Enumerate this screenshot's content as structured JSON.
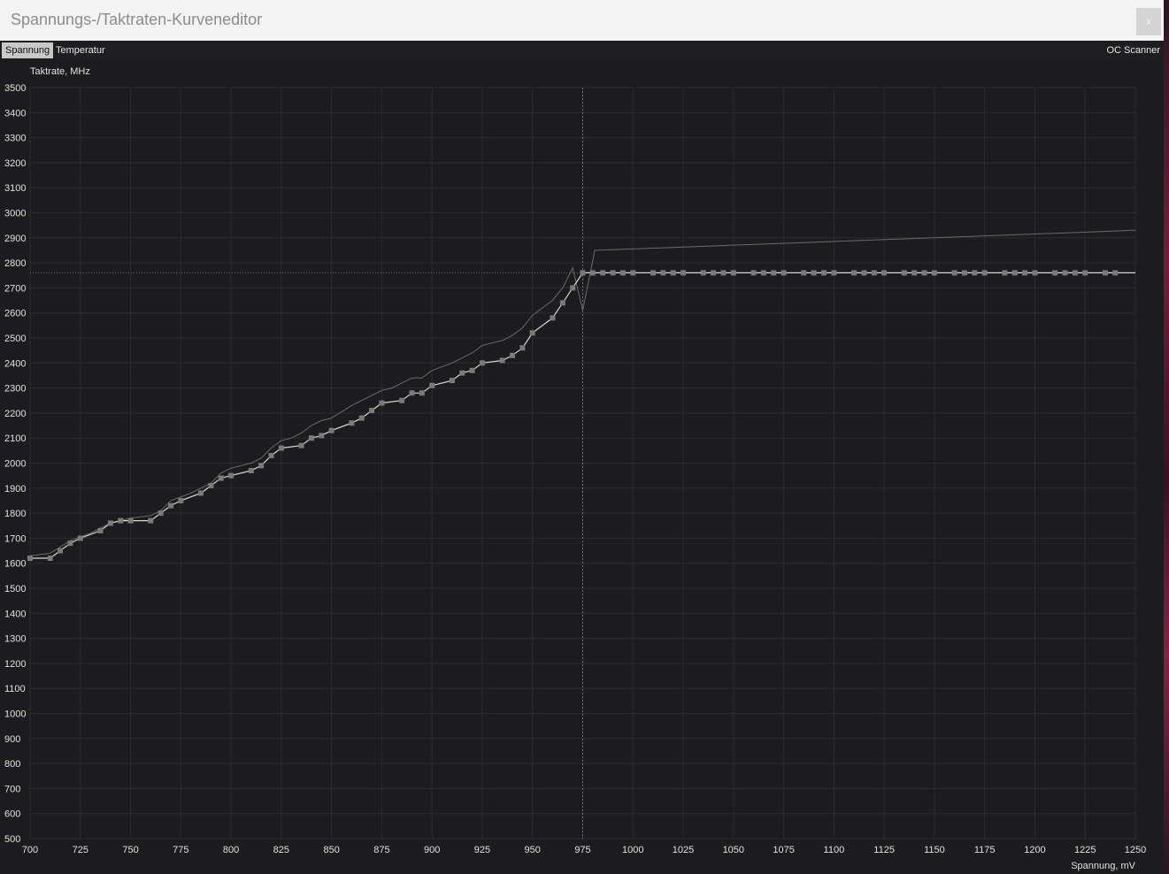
{
  "window": {
    "title": "Spannungs-/Taktraten-Kurveneditor",
    "close_label": "x"
  },
  "tabs": [
    {
      "label": "Spannung",
      "active": true
    },
    {
      "label": "Temperatur",
      "active": false
    }
  ],
  "toolbar": {
    "oc_scanner_label": "OC Scanner"
  },
  "colors": {
    "background": "#1c1c1e",
    "grid": "#2c2c2e",
    "curve": "#d8d8d8",
    "point": "#7a7a7a",
    "reference": "#6a6a6a"
  },
  "chart_data": {
    "type": "line",
    "ylabel": "Taktrate, MHz",
    "xlabel": "Spannung, mV",
    "xlim": [
      700,
      1250
    ],
    "ylim": [
      500,
      3500
    ],
    "x_ticks": [
      700,
      725,
      750,
      775,
      800,
      825,
      850,
      875,
      900,
      925,
      950,
      975,
      1000,
      1025,
      1050,
      1075,
      1100,
      1125,
      1150,
      1175,
      1200,
      1225,
      1250
    ],
    "y_ticks": [
      500,
      600,
      700,
      800,
      900,
      1000,
      1100,
      1200,
      1300,
      1400,
      1500,
      1600,
      1700,
      1800,
      1900,
      2000,
      2100,
      2200,
      2300,
      2400,
      2500,
      2600,
      2700,
      2800,
      2900,
      3000,
      3100,
      3200,
      3300,
      3400,
      3500
    ],
    "grid": true,
    "cursor_voltage": 975,
    "cursor_clock": 2760,
    "series": [
      {
        "role": "reference",
        "x": [
          700,
          710,
          720,
          730,
          740,
          750,
          760,
          765,
          770,
          780,
          790,
          795,
          800,
          810,
          815,
          820,
          825,
          830,
          835,
          840,
          845,
          850,
          860,
          870,
          875,
          880,
          885,
          890,
          895,
          900,
          910,
          915,
          920,
          925,
          930,
          935,
          940,
          945,
          950,
          955,
          960,
          965,
          970,
          975,
          981,
          1250
        ],
        "y": [
          1630,
          1640,
          1690,
          1720,
          1760,
          1780,
          1790,
          1810,
          1850,
          1880,
          1920,
          1960,
          1980,
          2000,
          2020,
          2060,
          2090,
          2100,
          2120,
          2150,
          2170,
          2180,
          2230,
          2270,
          2290,
          2300,
          2320,
          2340,
          2340,
          2370,
          2400,
          2420,
          2440,
          2470,
          2480,
          2490,
          2510,
          2540,
          2590,
          2620,
          2650,
          2700,
          2780,
          2610,
          2850,
          2930
        ]
      },
      {
        "role": "curve",
        "x": [
          700,
          710,
          715,
          720,
          725,
          735,
          740,
          745,
          750,
          760,
          765,
          770,
          775,
          785,
          790,
          795,
          800,
          810,
          815,
          820,
          825,
          835,
          840,
          845,
          850,
          860,
          865,
          870,
          875,
          885,
          890,
          895,
          900,
          910,
          915,
          920,
          925,
          935,
          940,
          945,
          950,
          960,
          965,
          970,
          975,
          1250
        ],
        "y": [
          1620,
          1620,
          1650,
          1680,
          1700,
          1730,
          1760,
          1770,
          1770,
          1770,
          1800,
          1830,
          1850,
          1880,
          1910,
          1940,
          1950,
          1970,
          1990,
          2030,
          2060,
          2070,
          2100,
          2110,
          2130,
          2160,
          2180,
          2210,
          2240,
          2250,
          2280,
          2280,
          2310,
          2330,
          2360,
          2370,
          2400,
          2410,
          2430,
          2460,
          2520,
          2580,
          2640,
          2700,
          2760,
          2760
        ]
      }
    ],
    "flat_points_x": [
      980,
      985,
      990,
      995,
      1000,
      1010,
      1015,
      1020,
      1025,
      1035,
      1040,
      1045,
      1050,
      1060,
      1065,
      1070,
      1075,
      1085,
      1090,
      1095,
      1100,
      1110,
      1115,
      1120,
      1125,
      1135,
      1140,
      1145,
      1150,
      1160,
      1165,
      1170,
      1175,
      1185,
      1190,
      1195,
      1200,
      1210,
      1215,
      1220,
      1225,
      1235,
      1240
    ],
    "flat_points_y": 2760
  }
}
